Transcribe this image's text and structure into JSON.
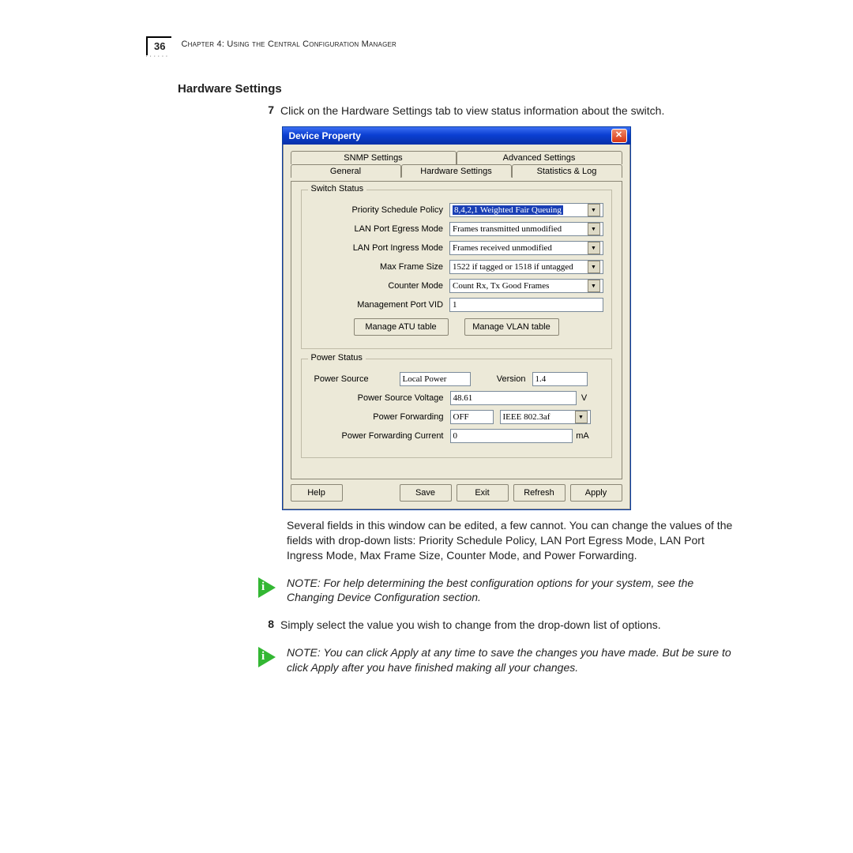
{
  "page_number": "36",
  "chapter_line": "Chapter 4: Using the Central Configuration Manager",
  "section_title": "Hardware Settings",
  "step7_num": "7",
  "step7_text": "Click on the Hardware Settings tab to view status information about the switch.",
  "window": {
    "title": "Device Property",
    "tabs_back": [
      "SNMP Settings",
      "Advanced Settings"
    ],
    "tabs_front": [
      "General",
      "Hardware Settings",
      "Statistics & Log"
    ],
    "switch_status": {
      "legend": "Switch Status",
      "priority_label": "Priority Schedule Policy",
      "priority_value": "8,4,2,1 Weighted Fair Queuing",
      "egress_label": "LAN Port Egress Mode",
      "egress_value": "Frames transmitted unmodified",
      "ingress_label": "LAN Port Ingress Mode",
      "ingress_value": "Frames received unmodified",
      "maxframe_label": "Max Frame Size",
      "maxframe_value": "1522 if tagged or 1518 if untagged",
      "counter_label": "Counter Mode",
      "counter_value": "Count Rx, Tx Good Frames",
      "mgmt_vid_label": "Management Port VID",
      "mgmt_vid_value": "1",
      "atu_btn": "Manage ATU table",
      "vlan_btn": "Manage VLAN table"
    },
    "power_status": {
      "legend": "Power Status",
      "source_label": "Power  Source",
      "source_value": "Local Power",
      "version_label": "Version",
      "version_value": "1.4",
      "voltage_label": "Power Source Voltage",
      "voltage_value": "48.61",
      "voltage_unit": "V",
      "forwarding_label": "Power Forwarding",
      "forwarding_value": "OFF",
      "forwarding_mode": "IEEE 802.3af",
      "current_label": "Power Forwarding Current",
      "current_value": "0",
      "current_unit": "mA"
    },
    "buttons": {
      "help": "Help",
      "save": "Save",
      "exit": "Exit",
      "refresh": "Refresh",
      "apply": "Apply"
    }
  },
  "para_after": "Several fields in this window can be edited, a few cannot. You can change the values of the fields with drop-down lists: Priority Schedule Policy, LAN Port Egress Mode, LAN Port Ingress Mode, Max Frame Size, Counter Mode, and Power Forwarding.",
  "note1": "NOTE:  For help determining the best configuration options for your system, see the Changing Device Configuration section.",
  "step8_num": "8",
  "step8_text": "Simply select the value you wish to change from the drop-down list of options.",
  "note2": "NOTE:  You can click Apply at any time to save the changes you have made. But be sure to click Apply after you have finished making all your changes."
}
